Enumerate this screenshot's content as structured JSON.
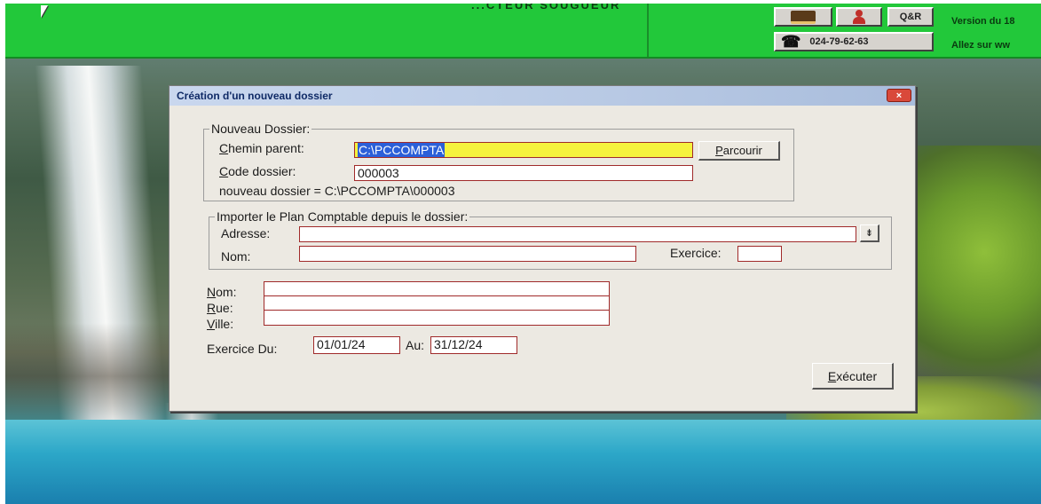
{
  "app": {
    "title": "...CTEUR SOUGUEUR"
  },
  "toolbar": {
    "qr_label": "Q&R",
    "phone": "024-79-62-63",
    "version_text": "Version du 18",
    "allez_text": "Allez sur ww"
  },
  "dialog": {
    "title": "Création d'un nouveau dossier",
    "close_label": "×",
    "nouveau_dossier": {
      "legend": "Nouveau Dossier:",
      "chemin_label_u": "C",
      "chemin_label_rest": "hemin parent:",
      "chemin_value": "C:\\PCCOMPTA",
      "parcourir_u": "P",
      "parcourir_rest": "arcourir",
      "code_label_u": "C",
      "code_label_rest": "ode dossier:",
      "code_value": "000003",
      "info": "nouveau dossier = C:\\PCCOMPTA\\000003"
    },
    "importer": {
      "legend": "Importer le Plan Comptable depuis le dossier:",
      "adresse_label": "Adresse:",
      "adresse_value": "",
      "browse_label": "⇟",
      "nom_label": "Nom:",
      "nom_value": "",
      "exercice_label": "Exercice:",
      "exercice_value": ""
    },
    "coordonnees": {
      "nom_label_u": "N",
      "nom_label_rest": "om:",
      "nom_value": "",
      "rue_label_u": "R",
      "rue_label_rest": "ue:",
      "rue_value": "",
      "ville_label_u": "V",
      "ville_label_rest": "ille:",
      "ville_value": ""
    },
    "exercice": {
      "du_label": "Exercice Du:",
      "du_value": "01/01/24",
      "au_label": "Au:",
      "au_value": "31/12/24"
    },
    "executer_u": "E",
    "executer_rest": "xécuter"
  }
}
